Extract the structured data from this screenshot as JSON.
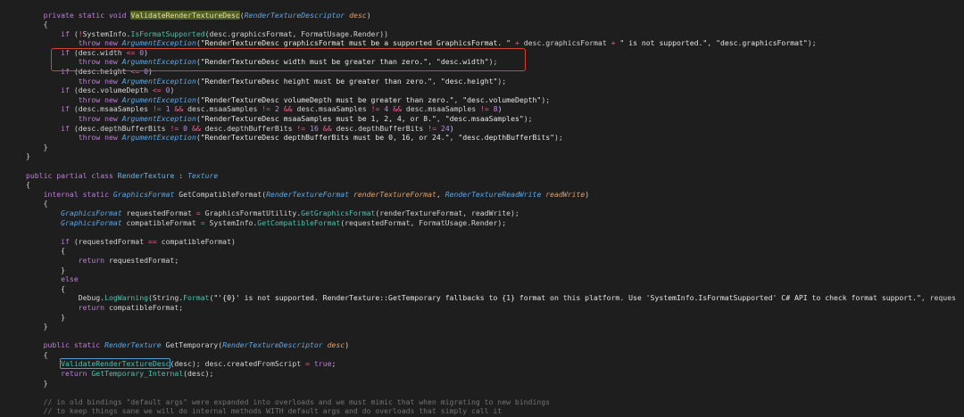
{
  "editor": {
    "colors": {
      "background": "#1e1e1e",
      "plain": "#d4d4d4",
      "keyword": "#c07edb",
      "type": "#5fa8e4",
      "class_name": "#6bb8ec",
      "method": "#4ec2ad",
      "string": "#e6e6e6",
      "operator": "#e5628f",
      "number": "#b48ee6",
      "param": "#e0a06e",
      "comment": "#737373",
      "highlight_text": "#e8e09a",
      "highlight_bg": "#4e5d25",
      "match_border": "#4f9bd3",
      "annotation": "#d8432f"
    },
    "lines": [
      [
        "    ",
        [
          "private",
          "#c07edb"
        ],
        " ",
        [
          "static",
          "#c07edb"
        ],
        " ",
        [
          "void",
          "#c07edb"
        ],
        " ",
        [
          "ValidateRenderTextureDesc",
          "#e8e09a",
          {
            "bg": "#4e5d25"
          }
        ],
        "(",
        [
          "RenderTextureDescriptor",
          "#5fa8e4"
        ],
        " ",
        [
          "desc",
          "#e0a06e"
        ],
        ")"
      ],
      [
        "    {"
      ],
      [
        "        ",
        [
          "if",
          "#c07edb"
        ],
        " (",
        [
          "!",
          "#e5628f"
        ],
        "SystemInfo.",
        [
          "IsFormatSupported",
          "#4ec2ad"
        ],
        "(desc.graphicsFormat, FormatUsage.Render))"
      ],
      [
        "            ",
        [
          "throw",
          "#c07edb"
        ],
        " ",
        [
          "new",
          "#c07edb"
        ],
        " ",
        [
          "ArgumentException",
          "#5fa8e4"
        ],
        "(",
        [
          "\"RenderTextureDesc graphicsFormat must be a supported GraphicsFormat. \"",
          "#e6e6e6"
        ],
        " ",
        [
          "+",
          "#e5628f"
        ],
        " desc.graphicsFormat ",
        [
          "+",
          "#e5628f"
        ],
        " ",
        [
          "\" is not supported.\"",
          "#e6e6e6"
        ],
        ", ",
        [
          "\"desc.graphicsFormat\"",
          "#e6e6e6"
        ],
        ");"
      ],
      [
        "        ",
        [
          "if",
          "#c07edb"
        ],
        " (desc.width ",
        [
          "<=",
          "#e5628f"
        ],
        " ",
        [
          "0",
          "#b48ee6"
        ],
        ")"
      ],
      [
        "            ",
        [
          "throw",
          "#c07edb"
        ],
        " ",
        [
          "new",
          "#c07edb"
        ],
        " ",
        [
          "ArgumentException",
          "#5fa8e4"
        ],
        "(",
        [
          "\"RenderTextureDesc width must be greater than zero.\"",
          "#e6e6e6"
        ],
        ", ",
        [
          "\"desc.width\"",
          "#e6e6e6"
        ],
        ");"
      ],
      [
        "        ",
        [
          "if",
          "#c07edb"
        ],
        " (desc.height ",
        [
          "<=",
          "#e5628f"
        ],
        " ",
        [
          "0",
          "#b48ee6"
        ],
        ")"
      ],
      [
        "            ",
        [
          "throw",
          "#c07edb"
        ],
        " ",
        [
          "new",
          "#c07edb"
        ],
        " ",
        [
          "ArgumentException",
          "#5fa8e4"
        ],
        "(",
        [
          "\"RenderTextureDesc height must be greater than zero.\"",
          "#e6e6e6"
        ],
        ", ",
        [
          "\"desc.height\"",
          "#e6e6e6"
        ],
        ");"
      ],
      [
        "        ",
        [
          "if",
          "#c07edb"
        ],
        " (desc.volumeDepth ",
        [
          "<=",
          "#e5628f"
        ],
        " ",
        [
          "0",
          "#b48ee6"
        ],
        ")"
      ],
      [
        "            ",
        [
          "throw",
          "#c07edb"
        ],
        " ",
        [
          "new",
          "#c07edb"
        ],
        " ",
        [
          "ArgumentException",
          "#5fa8e4"
        ],
        "(",
        [
          "\"RenderTextureDesc volumeDepth must be greater than zero.\"",
          "#e6e6e6"
        ],
        ", ",
        [
          "\"desc.volumeDepth\"",
          "#e6e6e6"
        ],
        ");"
      ],
      [
        "        ",
        [
          "if",
          "#c07edb"
        ],
        " (desc.msaaSamples ",
        [
          "!=",
          "#e5628f"
        ],
        " ",
        [
          "1",
          "#b48ee6"
        ],
        " ",
        [
          "&&",
          "#e5628f"
        ],
        " desc.msaaSamples ",
        [
          "!=",
          "#e5628f"
        ],
        " ",
        [
          "2",
          "#b48ee6"
        ],
        " ",
        [
          "&&",
          "#e5628f"
        ],
        " desc.msaaSamples ",
        [
          "!=",
          "#e5628f"
        ],
        " ",
        [
          "4",
          "#b48ee6"
        ],
        " ",
        [
          "&&",
          "#e5628f"
        ],
        " desc.msaaSamples ",
        [
          "!=",
          "#e5628f"
        ],
        " ",
        [
          "8",
          "#b48ee6"
        ],
        ")"
      ],
      [
        "            ",
        [
          "throw",
          "#c07edb"
        ],
        " ",
        [
          "new",
          "#c07edb"
        ],
        " ",
        [
          "ArgumentException",
          "#5fa8e4"
        ],
        "(",
        [
          "\"RenderTextureDesc msaaSamples must be 1, 2, 4, or 8.\"",
          "#e6e6e6"
        ],
        ", ",
        [
          "\"desc.msaaSamples\"",
          "#e6e6e6"
        ],
        ");"
      ],
      [
        "        ",
        [
          "if",
          "#c07edb"
        ],
        " (desc.depthBufferBits ",
        [
          "!=",
          "#e5628f"
        ],
        " ",
        [
          "0",
          "#b48ee6"
        ],
        " ",
        [
          "&&",
          "#e5628f"
        ],
        " desc.depthBufferBits ",
        [
          "!=",
          "#e5628f"
        ],
        " ",
        [
          "16",
          "#b48ee6"
        ],
        " ",
        [
          "&&",
          "#e5628f"
        ],
        " desc.depthBufferBits ",
        [
          "!=",
          "#e5628f"
        ],
        " ",
        [
          "24",
          "#b48ee6"
        ],
        ")"
      ],
      [
        "            ",
        [
          "throw",
          "#c07edb"
        ],
        " ",
        [
          "new",
          "#c07edb"
        ],
        " ",
        [
          "ArgumentException",
          "#5fa8e4"
        ],
        "(",
        [
          "\"RenderTextureDesc depthBufferBits must be 0, 16, or 24.\"",
          "#e6e6e6"
        ],
        ", ",
        [
          "\"desc.depthBufferBits\"",
          "#e6e6e6"
        ],
        ");"
      ],
      [
        "    }"
      ],
      [
        "}"
      ],
      [],
      [
        [
          "public",
          "#c07edb"
        ],
        " ",
        [
          "partial",
          "#c07edb"
        ],
        " ",
        [
          "class",
          "#c07edb"
        ],
        " ",
        [
          "RenderTexture",
          "#6bb8ec"
        ],
        " : ",
        [
          "Texture",
          "#5fa8e4"
        ]
      ],
      [
        "{"
      ],
      [
        "    ",
        [
          "internal",
          "#c07edb"
        ],
        " ",
        [
          "static",
          "#c07edb"
        ],
        " ",
        [
          "GraphicsFormat",
          "#5fa8e4"
        ],
        " GetCompatibleFormat(",
        [
          "RenderTextureFormat",
          "#5fa8e4"
        ],
        " ",
        [
          "renderTextureFormat",
          "#e0a06e"
        ],
        ", ",
        [
          "RenderTextureReadWrite",
          "#5fa8e4"
        ],
        " ",
        [
          "readWrite",
          "#e0a06e"
        ],
        ")"
      ],
      [
        "    {"
      ],
      [
        "        ",
        [
          "GraphicsFormat",
          "#5fa8e4"
        ],
        " requestedFormat ",
        [
          "=",
          "#e5628f"
        ],
        " GraphicsFormatUtility.",
        [
          "GetGraphicsFormat",
          "#4ec2ad"
        ],
        "(renderTextureFormat, readWrite);"
      ],
      [
        "        ",
        [
          "GraphicsFormat",
          "#5fa8e4"
        ],
        " compatibleFormat ",
        [
          "=",
          "#e5628f"
        ],
        " SystemInfo.",
        [
          "GetCompatibleFormat",
          "#4ec2ad"
        ],
        "(requestedFormat, FormatUsage.Render);"
      ],
      [],
      [
        "        ",
        [
          "if",
          "#c07edb"
        ],
        " (requestedFormat ",
        [
          "==",
          "#e5628f"
        ],
        " compatibleFormat)"
      ],
      [
        "        {"
      ],
      [
        "            ",
        [
          "return",
          "#c07edb"
        ],
        " requestedFormat;"
      ],
      [
        "        }"
      ],
      [
        "        ",
        [
          "else",
          "#c07edb"
        ]
      ],
      [
        "        {"
      ],
      [
        "            Debug.",
        [
          "LogWarning",
          "#4ec2ad"
        ],
        "(String.",
        [
          "Format",
          "#4ec2ad"
        ],
        "(",
        [
          "\"'{0}' is not supported. RenderTexture::GetTemporary fallbacks to {1} format on this platform. Use 'SystemInfo.IsFormatSupported' C# API to check format support.\"",
          "#e6e6e6"
        ],
        ", reques"
      ],
      [
        "            ",
        [
          "return",
          "#c07edb"
        ],
        " compatibleFormat;"
      ],
      [
        "        }"
      ],
      [
        "    }"
      ],
      [],
      [
        "    ",
        [
          "public",
          "#c07edb"
        ],
        " ",
        [
          "static",
          "#c07edb"
        ],
        " ",
        [
          "RenderTexture",
          "#5fa8e4"
        ],
        " GetTemporary(",
        [
          "RenderTextureDescriptor",
          "#5fa8e4"
        ],
        " ",
        [
          "desc",
          "#e0a06e"
        ],
        ")"
      ],
      [
        "    {"
      ],
      [
        "        ",
        [
          "ValidateRenderTextureDesc",
          "#4ec2ad",
          {
            "border": "#4f9bd3"
          }
        ],
        "(desc); desc.createdFromScript ",
        [
          "=",
          "#e5628f"
        ],
        " ",
        [
          "true",
          "#c07edb"
        ],
        ";"
      ],
      [
        "        ",
        [
          "return",
          "#c07edb"
        ],
        " ",
        [
          "GetTemporary_Internal",
          "#4ec2ad"
        ],
        "(desc);"
      ],
      [
        "    }"
      ],
      [],
      [
        "    ",
        [
          "// in old bindings \"default args\" were expanded into overloads and we must mimic that when migrating to new bindings",
          "#737373"
        ]
      ],
      [
        "    ",
        [
          "// to keep things sane we will do internal methods WITH default args and do overloads that simply call it",
          "#737373"
        ]
      ]
    ]
  }
}
